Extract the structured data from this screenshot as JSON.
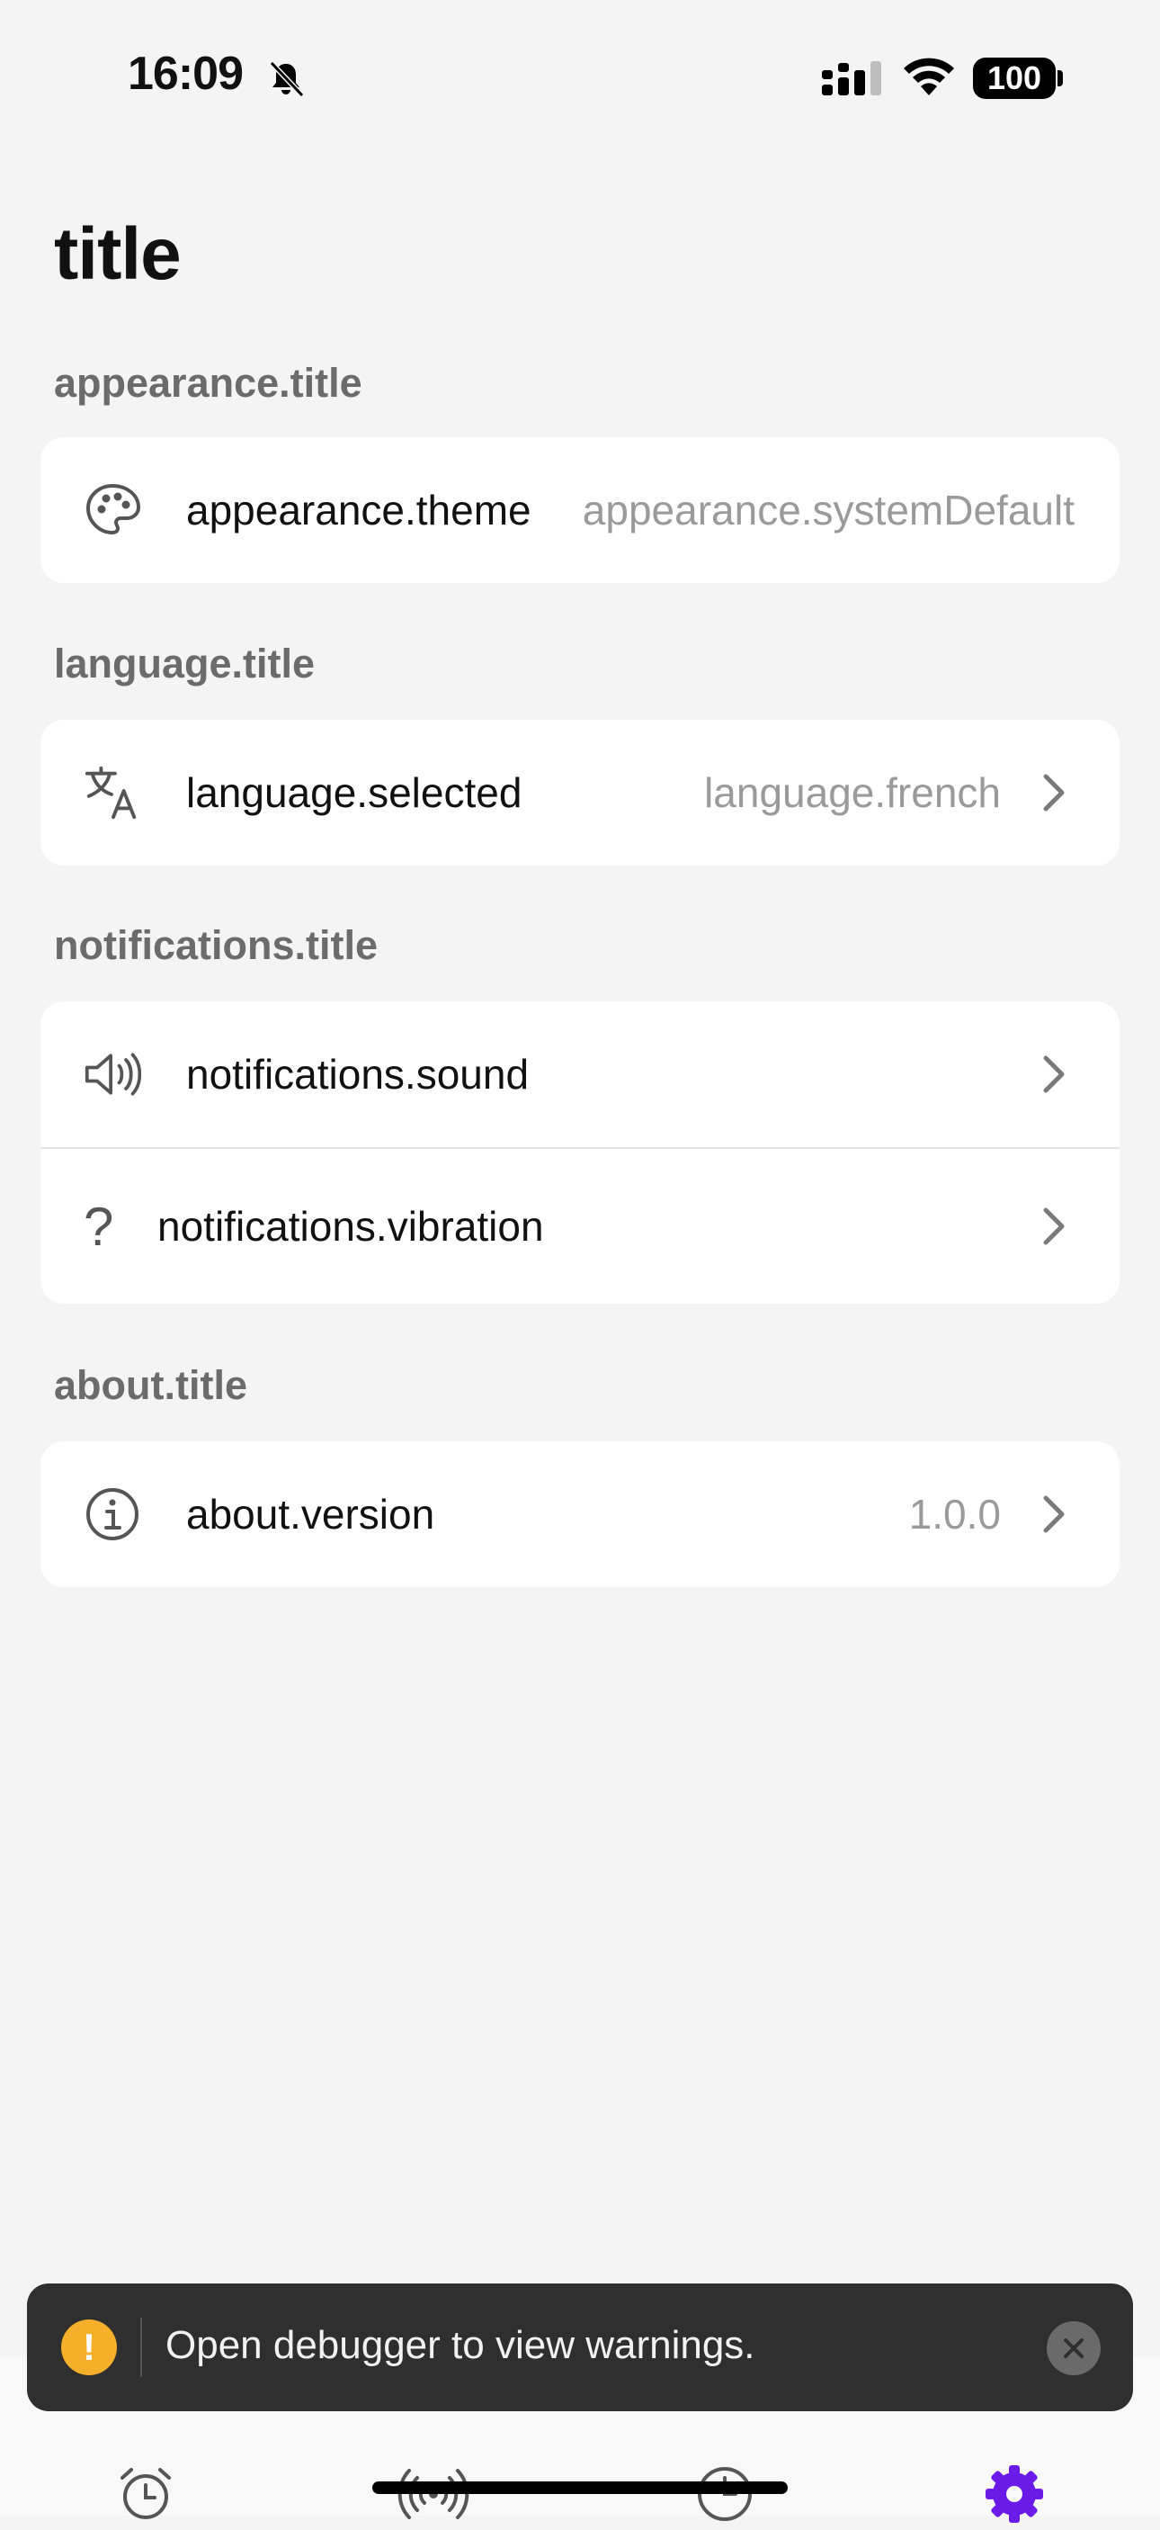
{
  "status_bar": {
    "time": "16:09",
    "battery": "100"
  },
  "page": {
    "title": "title"
  },
  "sections": {
    "appearance": {
      "header": "appearance.title",
      "theme_label": "appearance.theme",
      "theme_value": "appearance.systemDefault"
    },
    "language": {
      "header": "language.title",
      "selected_label": "language.selected",
      "selected_value": "language.french"
    },
    "notifications": {
      "header": "notifications.title",
      "sound_label": "notifications.sound",
      "vibration_label": "notifications.vibration",
      "vibration_icon": "?"
    },
    "about": {
      "header": "about.title",
      "version_label": "about.version",
      "version_value": "1.0.0"
    }
  },
  "toast": {
    "icon": "!",
    "message": "Open debugger to view warnings."
  },
  "tabbar": {
    "active_color": "#6a1be8",
    "items": [
      "alarm-icon",
      "broadcast-icon",
      "clock-icon",
      "gear-icon"
    ]
  },
  "icons": {
    "palette": "palette-icon",
    "translate": "translate-icon",
    "speaker": "speaker-icon",
    "info": "info-icon",
    "chevron": "chevron-right-icon"
  }
}
